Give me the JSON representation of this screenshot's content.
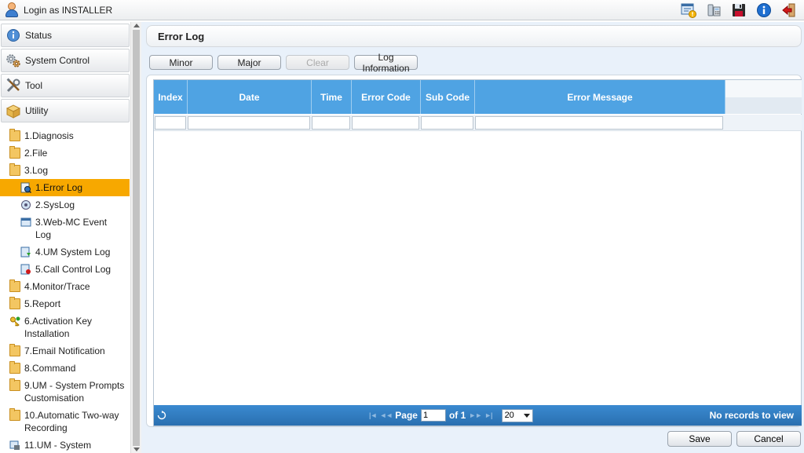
{
  "header": {
    "login_text": "Login as INSTALLER"
  },
  "top_icons": [
    "notification-icon",
    "phone-icon",
    "save-disk-icon",
    "info-icon",
    "logout-icon"
  ],
  "sidebar": {
    "accordions": [
      {
        "label": "Status",
        "icon": "info-icon"
      },
      {
        "label": "System Control",
        "icon": "gears-icon"
      },
      {
        "label": "Tool",
        "icon": "tools-icon"
      },
      {
        "label": "Utility",
        "icon": "box-icon"
      }
    ],
    "tree": {
      "diagnosis": "1.Diagnosis",
      "file": "2.File",
      "log": "3.Log",
      "error_log": "1.Error Log",
      "syslog": "2.SysLog",
      "webmc_event_log_1": "3.Web-MC Event",
      "webmc_event_log_2": "Log",
      "um_system_log": "4.UM System Log",
      "call_control_log": "5.Call Control Log",
      "monitor_trace": "4.Monitor/Trace",
      "report": "5.Report",
      "activation_key_1": "6.Activation Key",
      "activation_key_2": "Installation",
      "email_notification": "7.Email Notification",
      "command": "8.Command",
      "um_prompts_1": "9.UM - System Prompts",
      "um_prompts_2": "Customisation",
      "auto_two_way_1": "10.Automatic Two-way",
      "auto_two_way_2": "Recording",
      "um_system": "11.UM - System"
    }
  },
  "main": {
    "title": "Error Log",
    "buttons": {
      "minor": "Minor",
      "major": "Major",
      "clear": "Clear",
      "log_information": "Log Information"
    },
    "grid": {
      "columns": [
        "Index",
        "Date",
        "Time",
        "Error Code",
        "Sub Code",
        "Error Message"
      ],
      "rows": []
    },
    "pager": {
      "page_label": "Page",
      "page_value": "1",
      "of_label": "of 1",
      "page_size": "20",
      "status": "No records to view"
    },
    "save_label": "Save",
    "cancel_label": "Cancel"
  },
  "colors": {
    "header_blue": "#4fa3e3",
    "selected_orange": "#f7a800",
    "pager_blue": "#2f7cc0"
  }
}
